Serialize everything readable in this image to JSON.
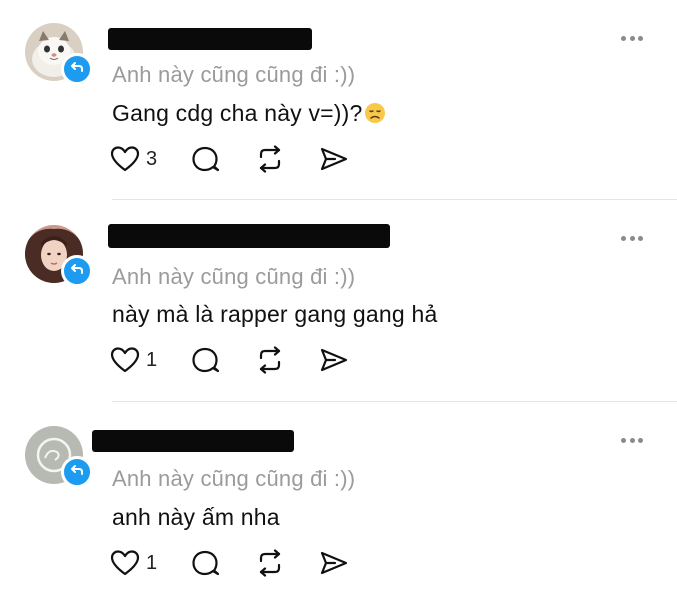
{
  "comments": [
    {
      "avatar": "cat-photo",
      "context": "Anh này cũng cũng đi :))",
      "text": "Gang cdg cha này v=))?",
      "emoji": "disappointed-face",
      "likes": "3"
    },
    {
      "avatar": "girl-portrait",
      "context": "Anh này cũng cũng đi :))",
      "text": "này mà là rapper gang gang hả",
      "likes": "1"
    },
    {
      "avatar": "gray-default",
      "context": "Anh này cũng cũng đi :))",
      "text": "anh này ấm nha",
      "likes": "1"
    }
  ],
  "icons": {
    "like": "heart-icon",
    "reply": "comment-bubble-icon",
    "repost": "repost-arrows-icon",
    "share": "send-icon",
    "more": "more-dots-icon",
    "badge": "repost-badge-icon"
  },
  "colors": {
    "badge": "#1d9bf0",
    "context_text": "#9b9b9b",
    "body_text": "#111111",
    "divider": "#e5e5e5"
  }
}
